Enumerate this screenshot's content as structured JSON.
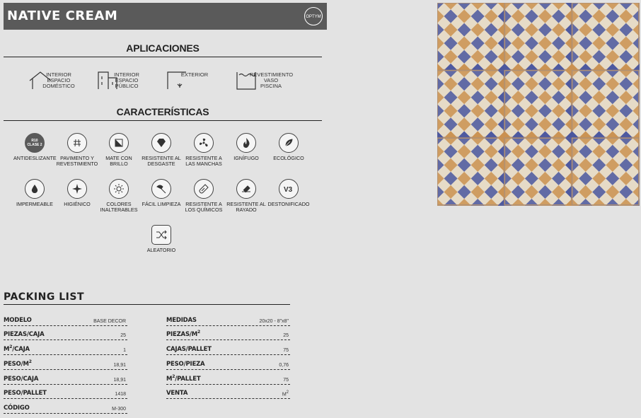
{
  "header": {
    "title": "NATIVE CREAM",
    "logo": "OPTYM"
  },
  "applications": {
    "title": "APLICACIONES",
    "items": [
      {
        "label": "INTERIOR\nESPACIO\nDOMÉSTICO",
        "icon": "house-icon"
      },
      {
        "label": "INTERIOR\nESPACIO\nPÚBLICO",
        "icon": "building-icon"
      },
      {
        "label": "EXTERIOR",
        "icon": "exterior-plant-icon"
      },
      {
        "label": "REVESTIMIENTO\nVASO\nPISCINA",
        "icon": "pool-icon"
      }
    ]
  },
  "features": {
    "title": "CARACTERÍSTICAS",
    "badge": "R10\nCLASE 2",
    "items": [
      {
        "label": "ANTIDESLIZANTE",
        "icon": "anti-slip-badge-icon"
      },
      {
        "label": "PAVIMENTO Y\nREVESTIMIENTO",
        "icon": "floor-wall-grid-icon"
      },
      {
        "label": "MATE CON\nBRILLO",
        "icon": "matte-gloss-icon"
      },
      {
        "label": "RESISTENTE AL\nDESGASTE",
        "icon": "diamond-icon"
      },
      {
        "label": "RESISTENTE A\nLAS MANCHAS",
        "icon": "stain-fan-icon"
      },
      {
        "label": "IGNÍFUGO",
        "icon": "flame-icon"
      },
      {
        "label": "ECOLÓGICO",
        "icon": "leaf-icon"
      },
      {
        "label": "IMPERMEABLE",
        "icon": "water-drop-icon"
      },
      {
        "label": "HIGIÉNICO",
        "icon": "sparkle-icon"
      },
      {
        "label": "COLORES\nINALTERABLES",
        "icon": "sun-icon"
      },
      {
        "label": "FÁCIL LIMPIEZA",
        "icon": "brush-icon"
      },
      {
        "label": "RESISTENTE A\nLOS QUÍMICOS",
        "icon": "test-tube-icon"
      },
      {
        "label": "RESISTENTE AL\nRAYADO",
        "icon": "scratch-icon"
      },
      {
        "label": "DESTONIFICADO",
        "icon": "v3-icon"
      },
      {
        "label": "ALEATORIO",
        "icon": "shuffle-icon"
      }
    ]
  },
  "packing": {
    "title": "PACKING LIST",
    "left": [
      {
        "k": "MODELO",
        "v": "BASE DECOR"
      },
      {
        "k": "PIEZAS/CAJA",
        "v": "25"
      },
      {
        "k": "M²/CAJA",
        "v": "1"
      },
      {
        "k": "PESO/M²",
        "v": "18,91"
      },
      {
        "k": "PESO/CAJA",
        "v": "18,91"
      },
      {
        "k": "PESO/PALLET",
        "v": "1418"
      },
      {
        "k": "CÓDIGO",
        "v": "M-300"
      }
    ],
    "right": [
      {
        "k": "MEDIDAS",
        "v": "20x20 - 8\"x8\""
      },
      {
        "k": "PIEZAS/M²",
        "v": "25"
      },
      {
        "k": "CAJAS/PALLET",
        "v": "75"
      },
      {
        "k": "PESO/PIEZA",
        "v": "0,76"
      },
      {
        "k": "M²/PALLET",
        "v": "75"
      },
      {
        "k": "VENTA",
        "v": "M²"
      }
    ]
  },
  "colors": {
    "blue": "#2c3f9e",
    "ochre": "#c8873e",
    "cream": "#e9e1cf",
    "header": "#5a5a5a"
  }
}
